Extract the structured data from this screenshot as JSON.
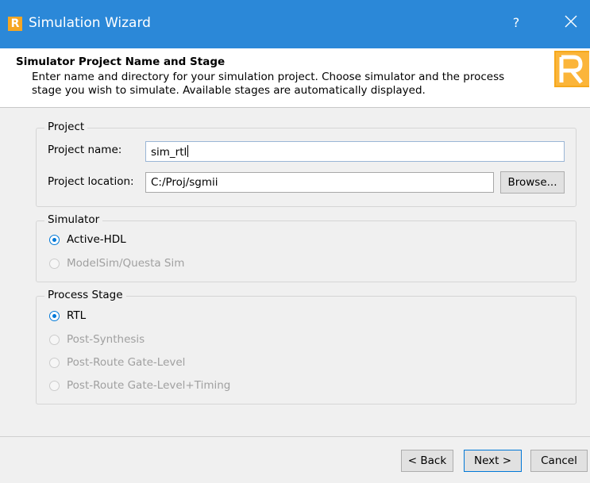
{
  "window": {
    "title": "Simulation Wizard",
    "app_icon_letter": "R",
    "help_label": "?",
    "title_bar_color": "#2b88d8"
  },
  "header": {
    "title": "Simulator Project Name and Stage",
    "description": "Enter name and directory for your simulation project. Choose simulator and the process stage you wish to simulate. Available stages are automatically displayed.",
    "logo_letter": "R"
  },
  "project": {
    "group_label": "Project",
    "name_label": "Project name:",
    "name_value": "sim_rtl",
    "location_label": "Project location:",
    "location_value": "C:/Proj/sgmii",
    "browse_label": "Browse..."
  },
  "simulator": {
    "group_label": "Simulator",
    "options": [
      {
        "label": "Active-HDL",
        "checked": true,
        "enabled": true
      },
      {
        "label": "ModelSim/Questa Sim",
        "checked": false,
        "enabled": false
      }
    ]
  },
  "process_stage": {
    "group_label": "Process Stage",
    "options": [
      {
        "label": "RTL",
        "checked": true,
        "enabled": true
      },
      {
        "label": "Post-Synthesis",
        "checked": false,
        "enabled": false
      },
      {
        "label": "Post-Route Gate-Level",
        "checked": false,
        "enabled": false
      },
      {
        "label": "Post-Route Gate-Level+Timing",
        "checked": false,
        "enabled": false
      }
    ]
  },
  "footer": {
    "back_label": "< Back",
    "next_label": "Next >",
    "cancel_label": "Cancel"
  }
}
